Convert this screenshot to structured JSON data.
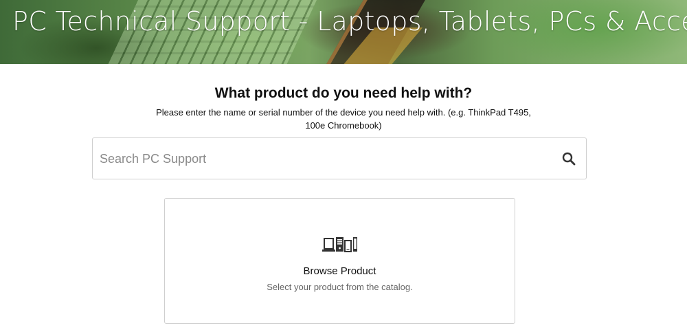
{
  "hero": {
    "title": "PC Technical Support - Laptops, Tablets, PCs & Accessories"
  },
  "main": {
    "question": "What product do you need help with?",
    "hint": "Please enter the name or serial number of the device you need help with. (e.g. ThinkPad T495, 100e Chromebook)"
  },
  "search": {
    "placeholder": "Search PC Support",
    "value": "",
    "icon": "search-icon"
  },
  "browse": {
    "title": "Browse Product",
    "description": "Select your product from the catalog.",
    "icon": "devices-icon"
  },
  "colors": {
    "text": "#111111",
    "muted": "#666666",
    "border": "#cfcfcf",
    "icon": "#333333"
  }
}
